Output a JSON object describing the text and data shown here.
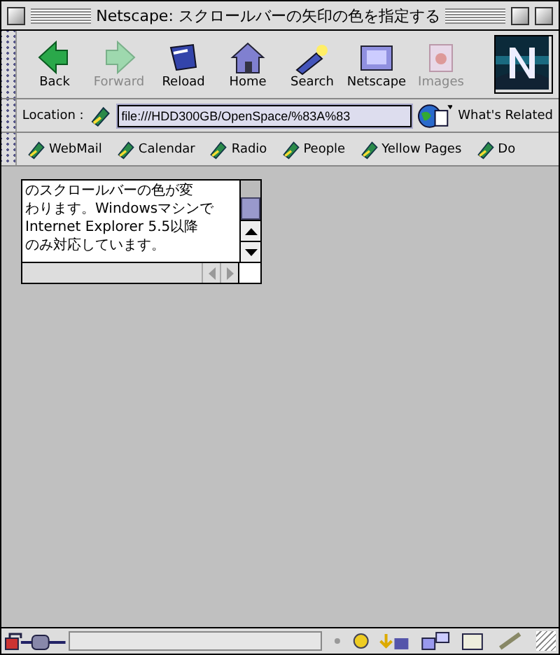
{
  "window": {
    "title": "Netscape: スクロールバーの矢印の色を指定する"
  },
  "toolbar": [
    {
      "label": "Back",
      "kind": "back",
      "disabled": false
    },
    {
      "label": "Forward",
      "kind": "forward",
      "disabled": true
    },
    {
      "label": "Reload",
      "kind": "reload",
      "disabled": false
    },
    {
      "label": "Home",
      "kind": "home",
      "disabled": false
    },
    {
      "label": "Search",
      "kind": "search",
      "disabled": false
    },
    {
      "label": "Netscape",
      "kind": "my",
      "disabled": false
    },
    {
      "label": "Images",
      "kind": "images",
      "disabled": true
    }
  ],
  "location": {
    "label": "Location :",
    "value": "file:///HDD300GB/OpenSpace/%83A%83",
    "related": "What's Related"
  },
  "personal_toolbar": [
    "WebMail",
    "Calendar",
    "Radio",
    "People",
    "Yellow Pages",
    "Do"
  ],
  "textarea": {
    "lines": [
      "のスクロールバーの色が変",
      "わります。Windowsマシンで",
      "Internet Explorer 5.5以降",
      "のみ対応しています。"
    ]
  }
}
